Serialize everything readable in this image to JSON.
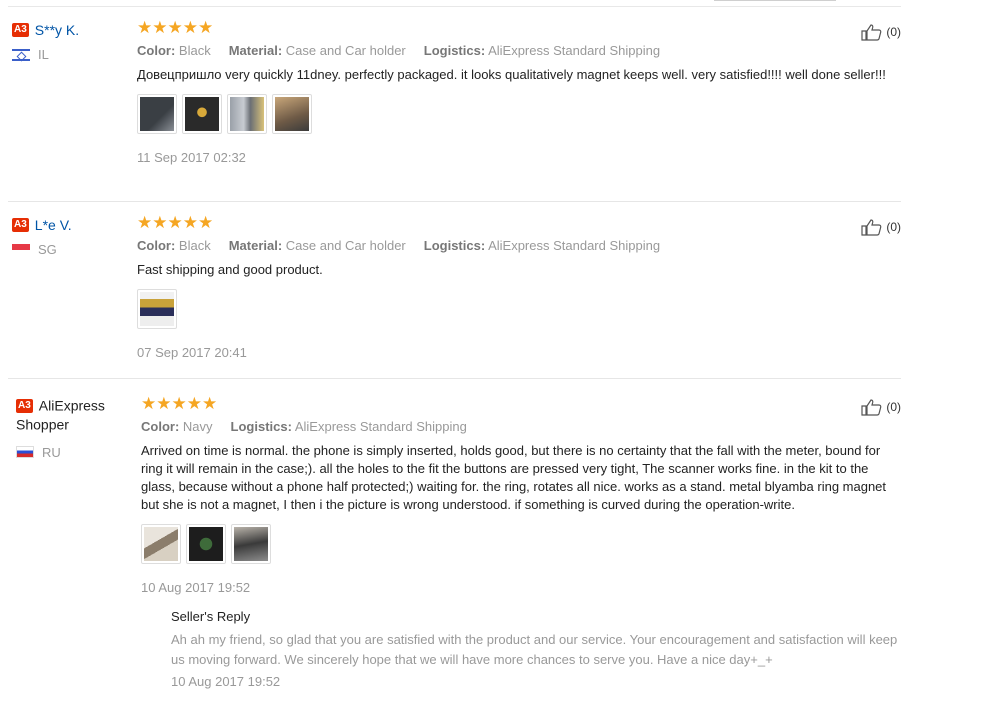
{
  "labels": {
    "color": "Color:",
    "material": "Material:",
    "logistics": "Logistics:",
    "seller_reply": "Seller's Reply"
  },
  "stars": "★★★★★",
  "reviews": [
    {
      "badge": "A3",
      "name": "S**y K.",
      "country": "IL",
      "rating": 5,
      "color": "Black",
      "material": "Case and Car holder",
      "logistics": "AliExpress Standard Shipping",
      "text": "Довецпришло very quickly 11dney. perfectly packaged. it looks qualitatively magnet keeps well. very satisfied!!!! well done seller!!!",
      "photo_count": 4,
      "date": "11 Sep 2017 02:32",
      "likes": "(0)"
    },
    {
      "badge": "A3",
      "name": "L*e V.",
      "country": "SG",
      "rating": 5,
      "color": "Black",
      "material": "Case and Car holder",
      "logistics": "AliExpress Standard Shipping",
      "text": "Fast shipping and good product.",
      "photo_count": 1,
      "date": "07 Sep 2017 20:41",
      "likes": "(0)"
    },
    {
      "badge": "A3",
      "name": "AliExpress Shopper",
      "country": "RU",
      "rating": 5,
      "color": "Navy",
      "logistics": "AliExpress Standard Shipping",
      "text": "Arrived on time is normal. the phone is simply inserted, holds good, but there is no certainty that the fall with the meter, bound for ring it will remain in the case;). all the holes to the fit the buttons are pressed very tight, The scanner works fine. in the kit to the glass, because without a phone half protected;) waiting for. the ring, rotates all nice. works as a stand. metal blyamba ring magnet but she is not a magnet, I then i the picture is wrong understood. if something is curved during the operation-write.",
      "photo_count": 3,
      "date": "10 Aug 2017 19:52",
      "likes": "(0)",
      "reply": {
        "text": "Ah ah my friend, so glad that you are satisfied with the product and our service. Your encouragement and satisfaction will keep us moving forward. We sincerely hope that we will have more chances to serve you. Have a nice day+_+",
        "date": "10 Aug 2017 19:52"
      }
    }
  ]
}
